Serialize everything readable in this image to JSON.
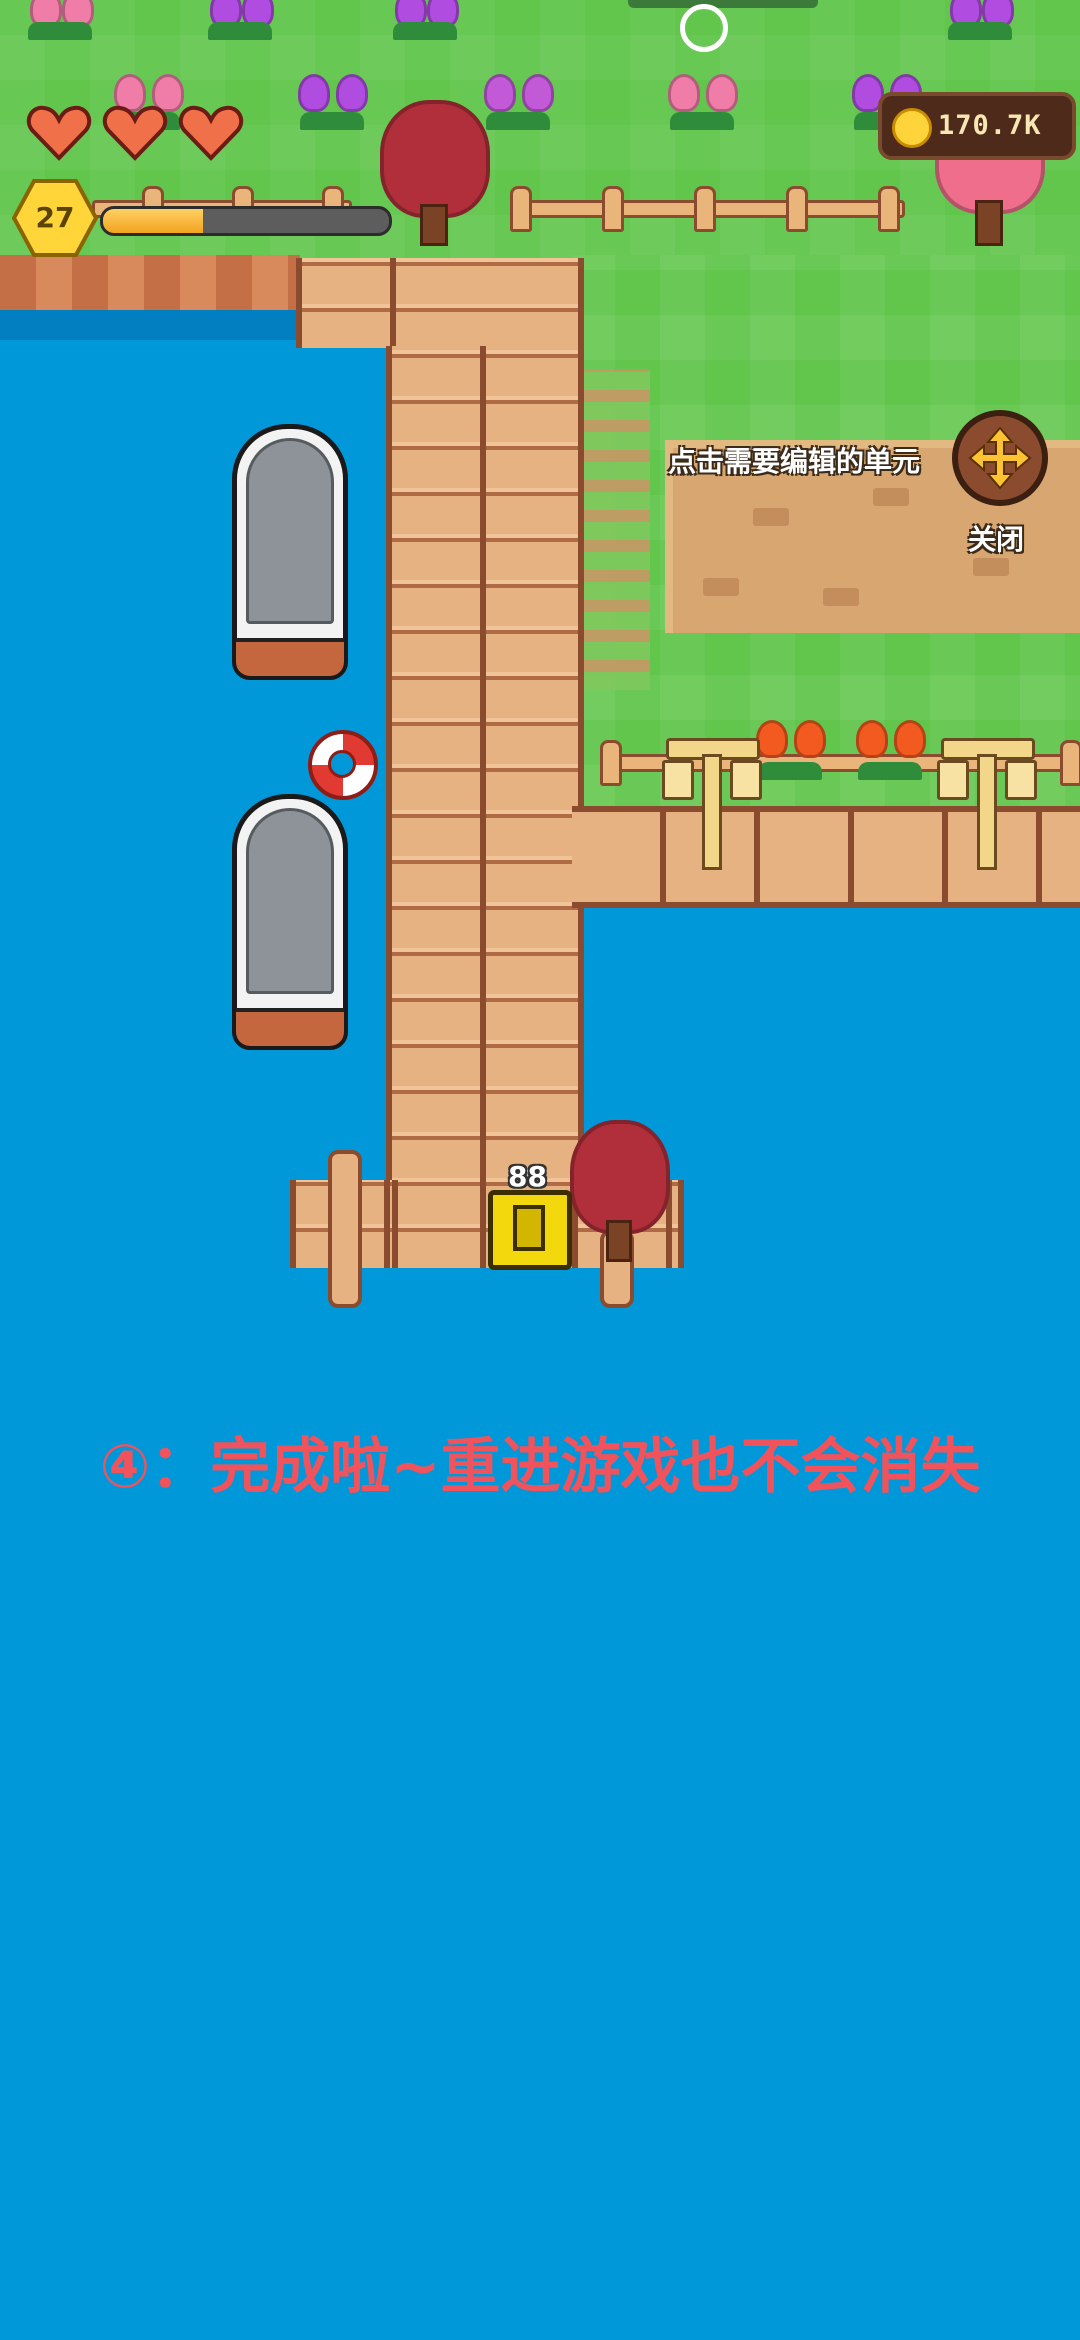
{
  "hud": {
    "hearts": 3,
    "level": "27",
    "xp_progress": 0.35,
    "coins": "170.7K",
    "colors": {
      "heart": "#f0704a",
      "level_hex": "#ffd53a",
      "xp_fill": "#f2a31f"
    }
  },
  "edit_mode": {
    "hint": "点击需要编辑的单元",
    "move_icon": "move-arrows-icon",
    "close_label": "关闭"
  },
  "scene": {
    "chest_count": "88"
  },
  "caption": "④：完成啦~重进游戏也不会消失"
}
